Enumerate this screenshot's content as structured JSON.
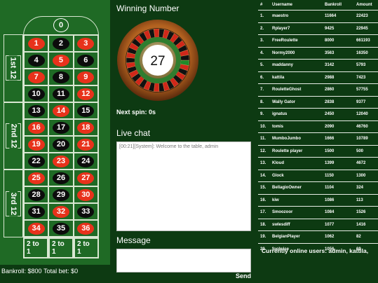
{
  "table": {
    "zero": "0",
    "rows": [
      [
        {
          "n": "1",
          "c": "red"
        },
        {
          "n": "2",
          "c": "black"
        },
        {
          "n": "3",
          "c": "red"
        }
      ],
      [
        {
          "n": "4",
          "c": "black"
        },
        {
          "n": "5",
          "c": "red"
        },
        {
          "n": "6",
          "c": "black"
        }
      ],
      [
        {
          "n": "7",
          "c": "red"
        },
        {
          "n": "8",
          "c": "black"
        },
        {
          "n": "9",
          "c": "red"
        }
      ],
      [
        {
          "n": "10",
          "c": "black"
        },
        {
          "n": "11",
          "c": "black"
        },
        {
          "n": "12",
          "c": "red"
        }
      ],
      [
        {
          "n": "13",
          "c": "black"
        },
        {
          "n": "14",
          "c": "red"
        },
        {
          "n": "15",
          "c": "black"
        }
      ],
      [
        {
          "n": "16",
          "c": "red"
        },
        {
          "n": "17",
          "c": "black"
        },
        {
          "n": "18",
          "c": "red"
        }
      ],
      [
        {
          "n": "19",
          "c": "red"
        },
        {
          "n": "20",
          "c": "black"
        },
        {
          "n": "21",
          "c": "red"
        }
      ],
      [
        {
          "n": "22",
          "c": "black"
        },
        {
          "n": "23",
          "c": "red"
        },
        {
          "n": "24",
          "c": "black"
        }
      ],
      [
        {
          "n": "25",
          "c": "red"
        },
        {
          "n": "26",
          "c": "black"
        },
        {
          "n": "27",
          "c": "red"
        }
      ],
      [
        {
          "n": "28",
          "c": "black"
        },
        {
          "n": "29",
          "c": "black"
        },
        {
          "n": "30",
          "c": "red"
        }
      ],
      [
        {
          "n": "31",
          "c": "black"
        },
        {
          "n": "32",
          "c": "red"
        },
        {
          "n": "33",
          "c": "black"
        }
      ],
      [
        {
          "n": "34",
          "c": "red"
        },
        {
          "n": "35",
          "c": "black"
        },
        {
          "n": "36",
          "c": "red"
        }
      ]
    ],
    "dozens": [
      "1st 12",
      "2nd 12",
      "3rd 12"
    ],
    "columns": [
      "2 to 1",
      "2 to 1",
      "2 to 1"
    ]
  },
  "footer": {
    "bankroll": "Bankroll: $800",
    "total_bet": "Total bet: $0"
  },
  "winning": {
    "title": "Winning Number",
    "number": "27",
    "next_spin": "Next spin: 0s"
  },
  "chat": {
    "title": "Live chat",
    "log": "[00:21][System]: Welcome to the table, admin",
    "message_title": "Message",
    "send": "Send"
  },
  "leaderboard": {
    "headers": [
      "#",
      "Username",
      "Bankroll",
      "Amount"
    ],
    "rows": [
      [
        "1.",
        "maestro",
        "11664",
        "22423"
      ],
      [
        "2.",
        "Rplayer7",
        "9425",
        "22945"
      ],
      [
        "3.",
        "FreeRoulette",
        "8000",
        "661193"
      ],
      [
        "4.",
        "Normy2000",
        "3563",
        "16350"
      ],
      [
        "5.",
        "maddanny",
        "3142",
        "5793"
      ],
      [
        "6.",
        "kattila",
        "2988",
        "7423"
      ],
      [
        "7.",
        "RouletteGhost",
        "2860",
        "57755"
      ],
      [
        "8.",
        "Wally Gator",
        "2838",
        "9377"
      ],
      [
        "9.",
        "ignatus",
        "2450",
        "12040"
      ],
      [
        "10.",
        "tomis",
        "2090",
        "46760"
      ],
      [
        "11.",
        "MumboJumbo",
        "1666",
        "10789"
      ],
      [
        "12.",
        "Roulette player",
        "1500",
        "500"
      ],
      [
        "13.",
        "Kloud",
        "1399",
        "4672"
      ],
      [
        "14.",
        "Glock",
        "1150",
        "1300"
      ],
      [
        "15.",
        "BellagioOwner",
        "1104",
        "324"
      ],
      [
        "16.",
        "kiw",
        "1086",
        "113"
      ],
      [
        "17.",
        "Smoozoor",
        "1084",
        "1526"
      ],
      [
        "18.",
        "swlesdiff",
        "1077",
        "1416"
      ],
      [
        "19.",
        "BelgianPlayer",
        "1062",
        "82"
      ],
      [
        "20.",
        "foolwise",
        "1056",
        "69"
      ]
    ],
    "online": "Currently online users: admin, kattila,"
  },
  "colors": {
    "felt": "#1f6a25",
    "background": "#0d3a12",
    "red": "#e8321b",
    "black": "#0c0c0c"
  }
}
